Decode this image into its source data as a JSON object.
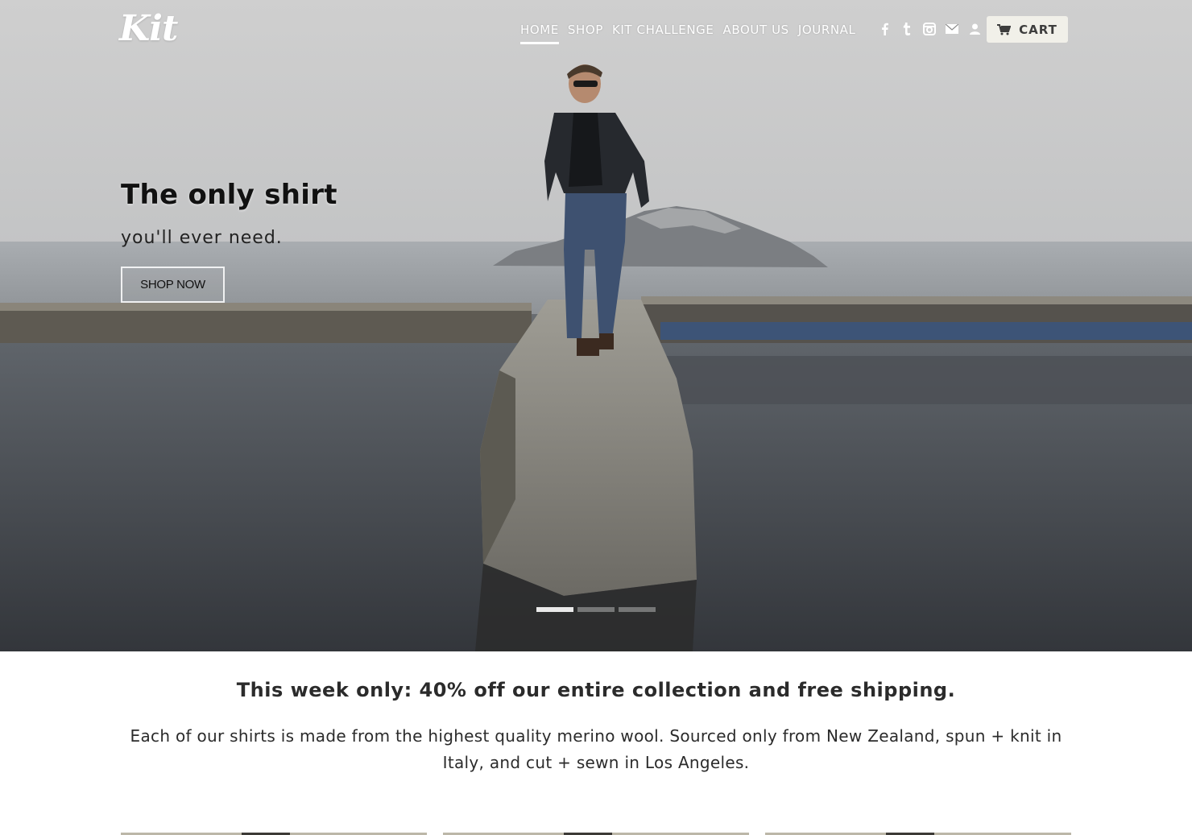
{
  "brand": {
    "logo_text": "Kit"
  },
  "nav": {
    "items": [
      {
        "label": "HOME",
        "active": true
      },
      {
        "label": "SHOP",
        "active": false
      },
      {
        "label": "KIT CHALLENGE",
        "active": false
      },
      {
        "label": "ABOUT US",
        "active": false
      },
      {
        "label": "JOURNAL",
        "active": false
      }
    ],
    "social_icons": [
      "facebook-icon",
      "tumblr-icon",
      "instagram-icon",
      "email-icon",
      "account-icon"
    ],
    "cart_label": "CART",
    "cart_icon": "cart-icon"
  },
  "hero": {
    "title": "The only shirt",
    "subtitle": "you'll ever need.",
    "cta_label": "SHOP NOW",
    "slides": [
      {
        "active": true
      },
      {
        "active": false
      },
      {
        "active": false
      }
    ]
  },
  "promo": {
    "headline": "This week only: 40% off our entire collection and free shipping.",
    "body": "Each of our shirts is made from the highest quality merino wool. Sourced only from New Zealand, spun + knit in Italy, and cut + sewn in Los Angeles."
  },
  "colors": {
    "nav_text": "#ffffff",
    "cart_bg": "#f1f0e9",
    "body_text": "#2b2b2b"
  }
}
